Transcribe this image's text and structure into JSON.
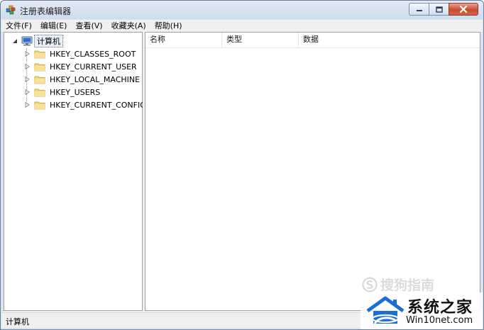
{
  "window": {
    "title": "注册表编辑器",
    "icon": "registry-editor-icon"
  },
  "menu": [
    {
      "label": "文件(F)"
    },
    {
      "label": "编辑(E)"
    },
    {
      "label": "查看(V)"
    },
    {
      "label": "收藏夹(A)"
    },
    {
      "label": "帮助(H)"
    }
  ],
  "tree": {
    "root": {
      "label": "计算机",
      "icon": "computer-icon",
      "expanded": true
    },
    "children": [
      {
        "label": "HKEY_CLASSES_ROOT",
        "icon": "folder-icon"
      },
      {
        "label": "HKEY_CURRENT_USER",
        "icon": "folder-icon"
      },
      {
        "label": "HKEY_LOCAL_MACHINE",
        "icon": "folder-icon"
      },
      {
        "label": "HKEY_USERS",
        "icon": "folder-icon"
      },
      {
        "label": "HKEY_CURRENT_CONFIG",
        "icon": "folder-icon"
      }
    ]
  },
  "list": {
    "columns": [
      {
        "label": "名称"
      },
      {
        "label": "类型"
      },
      {
        "label": "数据"
      }
    ]
  },
  "status": {
    "text": "计算机"
  },
  "watermarks": {
    "sougou": "搜狗指南",
    "brand_name": "系统之家",
    "brand_url": "Win10net.com"
  },
  "colors": {
    "title_gradient_top": "#e3ebf6",
    "close_button": "#c94b2e",
    "brand_blue": "#1a6fd1"
  }
}
